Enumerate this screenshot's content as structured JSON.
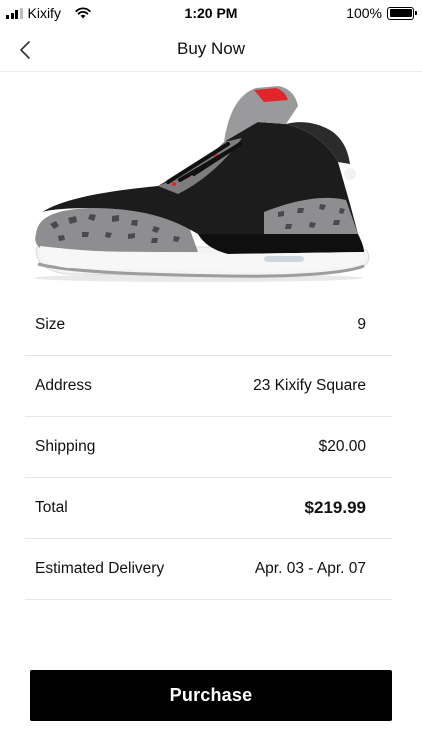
{
  "status_bar": {
    "carrier": "Kixify",
    "time": "1:20 PM",
    "battery_percent": "100%"
  },
  "nav": {
    "title": "Buy Now",
    "back_icon": "chevron-left-icon"
  },
  "product": {
    "image_icon": "sneaker-image",
    "colors": {
      "upper": "#1d1d1d",
      "cement": "#8a8a8e",
      "accent": "#e0262b",
      "sole": "#f3f3f3"
    }
  },
  "details": [
    {
      "label": "Size",
      "value": "9"
    },
    {
      "label": "Address",
      "value": "23 Kixify Square"
    },
    {
      "label": "Shipping",
      "value": "$20.00"
    },
    {
      "label": "Total",
      "value": "$219.99"
    },
    {
      "label": "Estimated Delivery",
      "value": "Apr. 03 - Apr. 07"
    }
  ],
  "purchase": {
    "label": "Purchase"
  }
}
